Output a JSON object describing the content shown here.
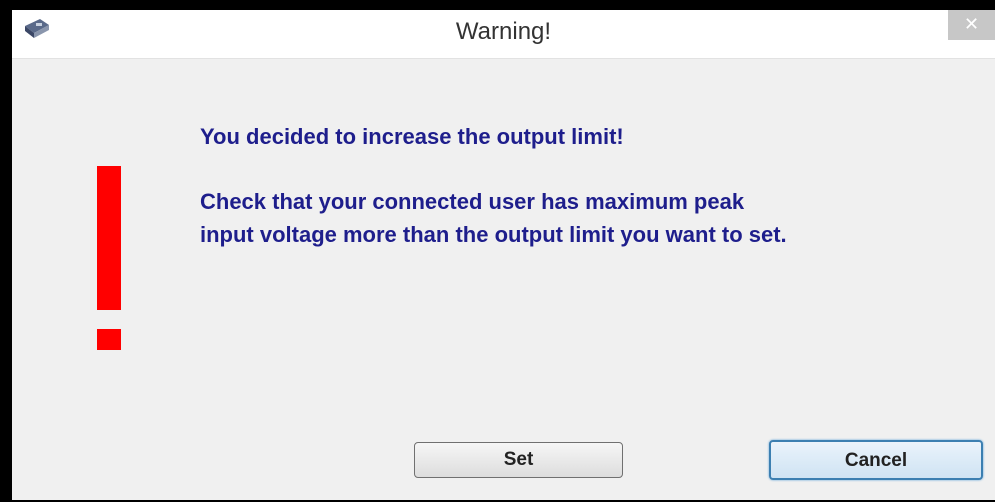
{
  "window": {
    "title": "Warning!",
    "close_label": "✕"
  },
  "message": {
    "line1": "You decided to increase the output limit!",
    "line2": "Check that your connected user has maximum peak",
    "line3": "input voltage more than the output limit you want to set."
  },
  "buttons": {
    "set_label": "Set",
    "cancel_label": "Cancel"
  },
  "colors": {
    "message_text": "#1e1e8c",
    "warning_icon": "#ff0000",
    "focus_border": "#3c7fb1"
  }
}
